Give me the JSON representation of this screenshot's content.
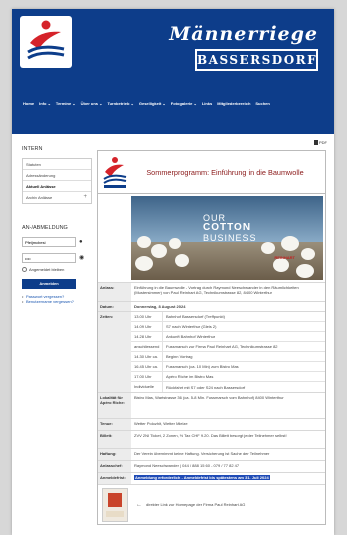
{
  "header": {
    "title": "Männerriege",
    "subtitle": "BASSERSDORF"
  },
  "nav": [
    "Home",
    "Info ⌄",
    "Termine ⌄",
    "Über uns ⌄",
    "Turnbetrieb ⌄",
    "Geselligkeit ⌄",
    "Fotogalerie ⌄",
    "Links",
    "Mitgliederbereich",
    "Suchen"
  ],
  "pdf_label": "PDF",
  "sidebar": {
    "heading": "INTERN",
    "items": [
      {
        "label": "Statuten"
      },
      {
        "label": "Adressänderung"
      },
      {
        "label": "Aktuell Anlässe"
      },
      {
        "label": "Archiv Anlässe"
      }
    ],
    "login_heading": "AN-/ABMELDUNG",
    "username_value": "Pfeijmcbesi",
    "password_value": "••••",
    "remember_label": "Angemeldet bleiben",
    "login_button": "Anmelden",
    "links": [
      "Passwort vergessen?",
      "Benutzername vergessen?"
    ]
  },
  "event": {
    "title": "Sommerprogramm: Einführung in die Baumwolle",
    "hero": {
      "line1": "OUR",
      "line2": "COTTON",
      "line3": "BUSINESS",
      "brand": "REINHART"
    },
    "rows": {
      "anlass_label": "Anlass:",
      "anlass_value": "Einführung in die Baumwolle - Vortrag durch Raymond Neeschwander in den Räumlichkeiten (Mustersimmer) von Paul Reinhart AG, Technikumstrasse 82, 8400 Winterthur",
      "datum_label": "Datum:",
      "datum_value": "Donnerstag, 8 August 2024",
      "zeiten_label": "Zeiten:",
      "zeiten": [
        {
          "time": "13.00 Uhr",
          "desc": "Bahnhof Bassersdorf (Treffpunkt)"
        },
        {
          "time": "14.09 Uhr",
          "desc": "S7 nach Winterthur (Gleis 2)"
        },
        {
          "time": "14.28 Uhr",
          "desc": "Ankunft Bahnhof Winterthur"
        },
        {
          "time": "anschliessend",
          "desc": "Fussmarsch zur Firma Paul Reinhart AG, Technikumstrasse 82"
        },
        {
          "time": "14.30 Uhr ca.",
          "desc": "Beginn Vortrag"
        },
        {
          "time": "16.45 Uhr ca.",
          "desc": "Fussmarsch (ca. 10 Min) zum Bistro Mas"
        },
        {
          "time": "17.00 Uhr",
          "desc": "Apéro Riche im Bistro Mas"
        },
        {
          "time": "Individuelle",
          "desc": "Rückfahrt mit S7 oder S24 nach Bassersdorf"
        }
      ],
      "lokal_label": "Lokalität für Apéro Riche:",
      "lokal_value": "Bistro Mas, Wartstrasse 36 (ca. 5-8 Min. Fussmarsch vom Bahnhof) 8400 Winterthur",
      "tenue_label": "Tenue:",
      "tenue_value": "Wetter Polozhit, Wetter Mielze",
      "billett_label": "Billett:",
      "billett_value": "ZVV 2NI Ticket, 2 Zonen, ½ Tax CHF 9.20. Das Billett besorgt jeder Teilnehmer selbst!",
      "haftung_label": "Haftung:",
      "haftung_value": "Der Verein übernimmt keine Haftung. Versicherung ist Sache der Teilnehmer",
      "anlasschef_label": "Anlasschef:",
      "anlasschef_value": "Raymond Neeschwander | 044 / 888 15 60 - 079 / 77 82 47",
      "anmeldung_label": "Anmeldefrist:",
      "anmeldung_value": "Anmeldung erforderlich - Anmeldefrist bis spätestens am 31. Juli 2024"
    },
    "footer_text": "direkter Link zur Homepage der Firma Paul Reinhart AG"
  },
  "colors": {
    "brand_blue": "#0d3d8a",
    "title_red": "#8b1a1a",
    "highlight_blue": "#1f4bb6"
  }
}
